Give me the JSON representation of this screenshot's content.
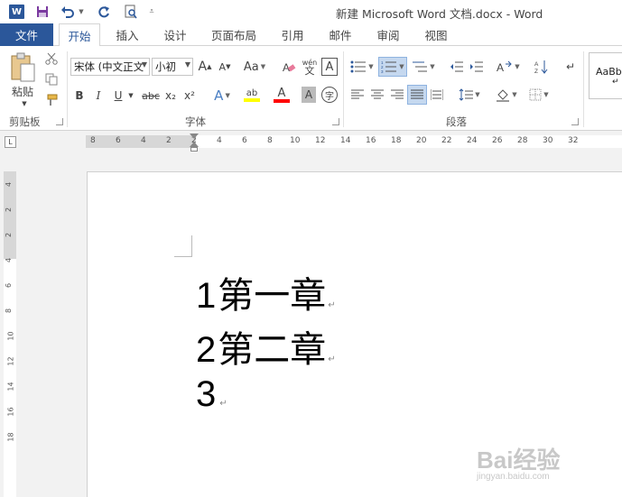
{
  "window": {
    "title": "新建 Microsoft Word 文档.docx - Word"
  },
  "quick_access": {
    "logo_letter": "W",
    "icons": [
      "save-icon",
      "undo-icon",
      "redo-icon",
      "print-preview-icon",
      "customize-icon"
    ]
  },
  "tabs": [
    {
      "label": "文件"
    },
    {
      "label": "开始",
      "active": true
    },
    {
      "label": "插入"
    },
    {
      "label": "设计"
    },
    {
      "label": "页面布局"
    },
    {
      "label": "引用"
    },
    {
      "label": "邮件"
    },
    {
      "label": "审阅"
    },
    {
      "label": "视图"
    }
  ],
  "ribbon": {
    "clipboard": {
      "label": "剪贴板",
      "paste_label": "粘贴"
    },
    "font": {
      "label": "字体",
      "font_name": "宋体 (中文正文",
      "font_size": "小初",
      "grow": "A",
      "shrink": "A",
      "case": "Aa",
      "phonetic": "wén",
      "phonetic_sub": "文",
      "border_char": "A",
      "bold": "B",
      "italic": "I",
      "underline": "U",
      "strike": "abc",
      "subscript": "x₂",
      "superscript": "x²",
      "effects": "A",
      "highlight": "ab",
      "font_color": "A",
      "shading": "A",
      "enclose": "字"
    },
    "paragraph": {
      "label": "段落"
    },
    "styles": {
      "preview": "AaBb",
      "sub": "↵"
    }
  },
  "ruler": {
    "corner": "L",
    "h_labels": [
      "8",
      "6",
      "4",
      "2",
      "2",
      "4",
      "6",
      "8",
      "10",
      "12",
      "14",
      "16",
      "18",
      "20",
      "22",
      "24",
      "26",
      "28",
      "30",
      "32"
    ],
    "v_labels": [
      "4",
      "2",
      "2",
      "4",
      "6",
      "8",
      "10",
      "12",
      "14",
      "16",
      "18"
    ]
  },
  "document": {
    "lines": [
      {
        "num": "1",
        "text": "第一章"
      },
      {
        "num": "2",
        "text": "第二章"
      },
      {
        "num": "3",
        "text": ""
      }
    ],
    "para_mark": "↵"
  },
  "watermark": {
    "brand": "Bai经验",
    "url": "jingyan.baidu.com"
  },
  "colors": {
    "accent": "#2b579a",
    "highlight": "#ffff00",
    "font_color": "#ff0000"
  }
}
